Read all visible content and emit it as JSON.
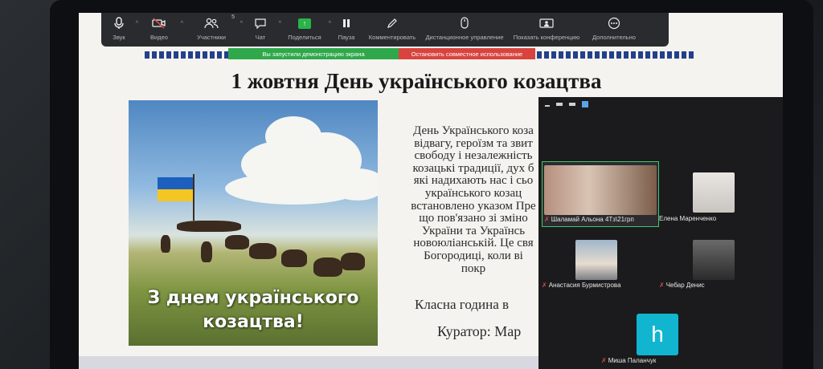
{
  "toolbar": {
    "items": [
      {
        "label": "Звук",
        "icon": "microphone-icon"
      },
      {
        "label": "Видео",
        "icon": "video-off-icon"
      },
      {
        "label": "Участники",
        "icon": "participants-icon",
        "count": "5"
      },
      {
        "label": "Чат",
        "icon": "chat-icon"
      },
      {
        "label": "Поделиться",
        "icon": "share-screen-icon"
      },
      {
        "label": "Пауза",
        "icon": "pause-icon"
      },
      {
        "label": "Комментировать",
        "icon": "annotate-icon"
      },
      {
        "label": "Дистанционное управление",
        "icon": "remote-control-icon"
      },
      {
        "label": "Показать конференцию",
        "icon": "show-meeting-icon"
      },
      {
        "label": "Дополнительно",
        "icon": "more-icon"
      }
    ]
  },
  "share_bar": {
    "status": "Вы запустили демонстрацию экрана",
    "stop": "Остановить совместное использование",
    "status_color": "#2fa84b",
    "stop_color": "#d9433e"
  },
  "slide": {
    "title": "1 жовтня День українського козацтва",
    "poster_caption_line1": "З днем українського",
    "poster_caption_line2": "козацтва!",
    "body_lines": [
      "День Українського коза",
      "відвагу, героїзм та звит",
      "свободу і незалежність",
      "козацькі традиції, дух б",
      "які надихають нас і сьо",
      "українського козац",
      "встановлено указом Пре",
      "що пов'язано зі зміно",
      "України та Українсь",
      "новоюліанській. Це свя",
      "Богородиці, коли ві",
      "покр"
    ],
    "footer1": "Класна година в",
    "footer2": "Куратор: Мар"
  },
  "gallery": {
    "participants": [
      {
        "name": "Шаламай Альона 4Тз\\21грп",
        "muted": true
      },
      {
        "name": "Елена Маренченко",
        "muted": false
      },
      {
        "name": "Анастасия Бурмистрова",
        "muted": true
      },
      {
        "name": "Чебар Денис",
        "muted": true
      },
      {
        "name": "Миша Паланчук",
        "muted": true,
        "avatar_letter": "h"
      }
    ]
  }
}
